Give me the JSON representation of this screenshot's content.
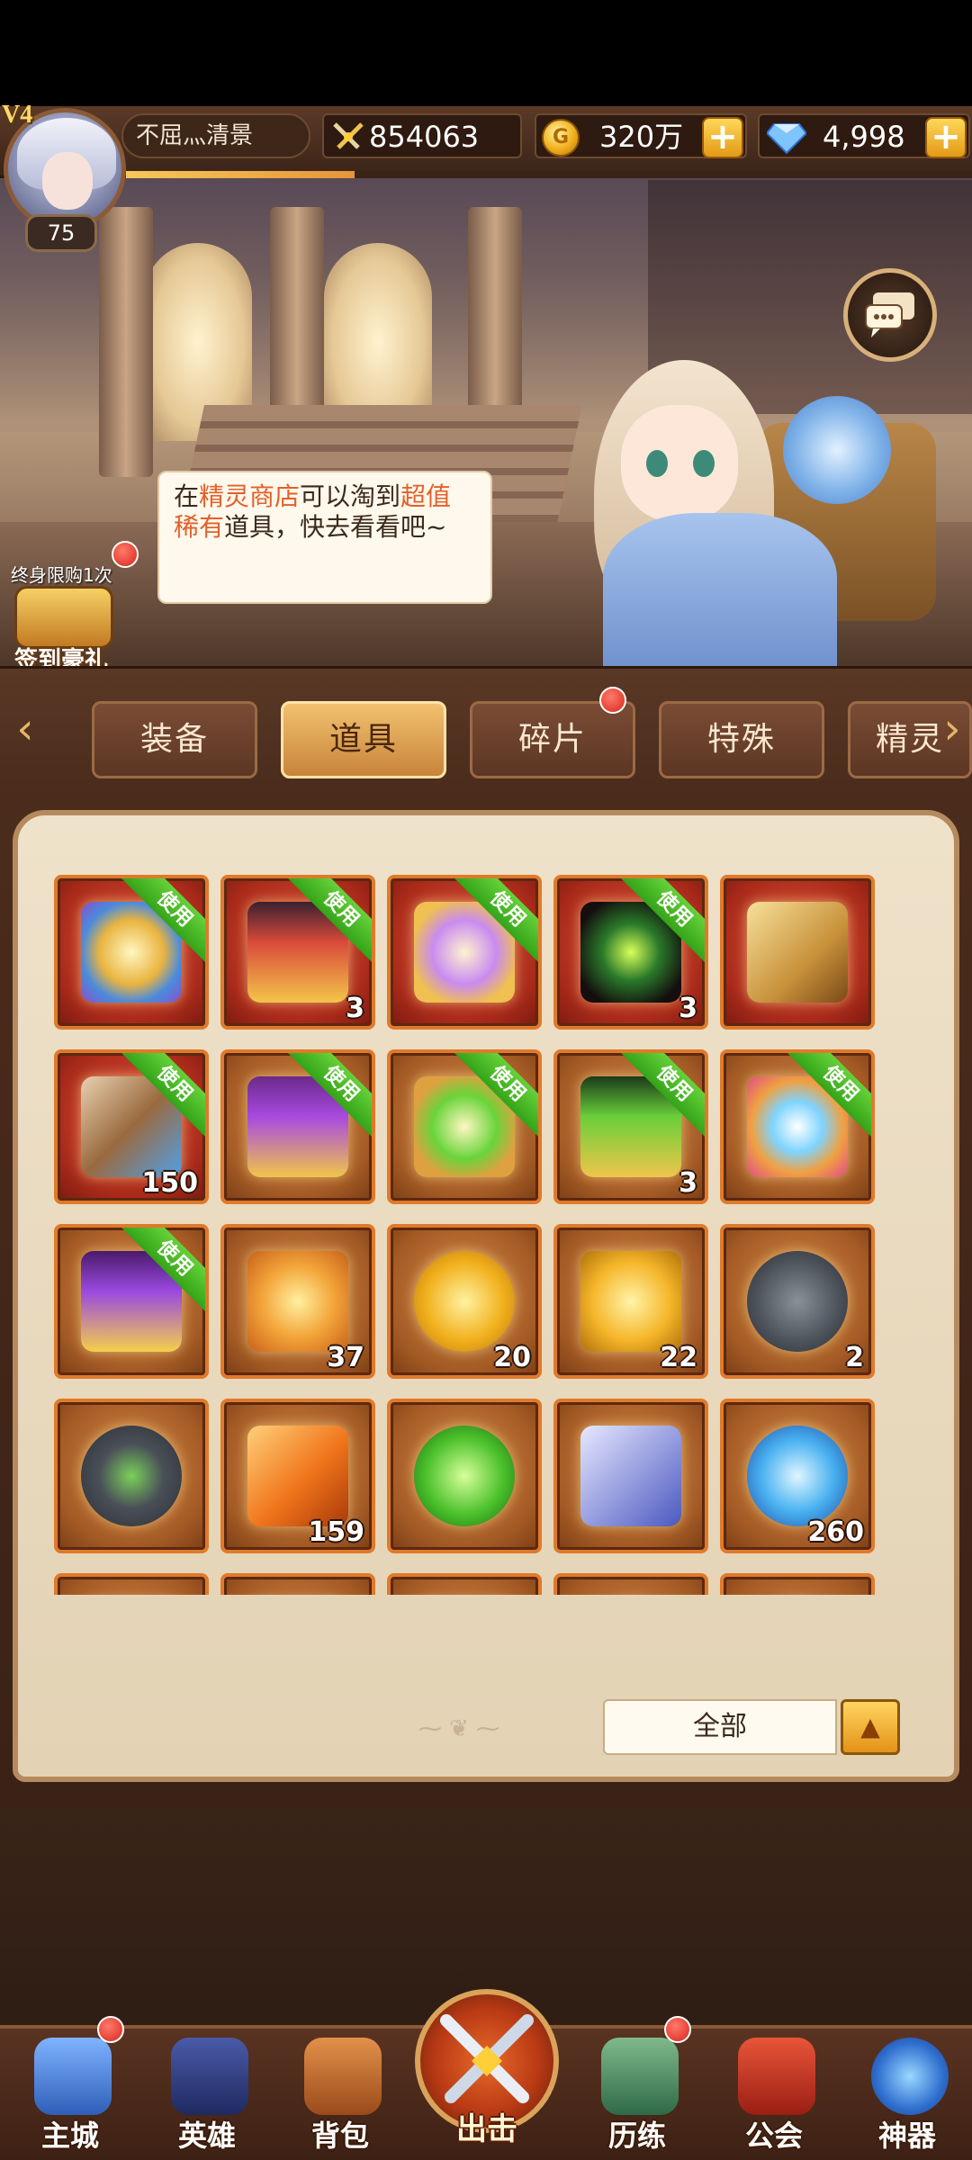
{
  "player": {
    "vip": "V4",
    "level": "75",
    "name": "不屈灬清景",
    "power": "854063",
    "gold": "320万",
    "diamonds": "4,998",
    "exp_progress": 0.27
  },
  "npc_bubble": {
    "t1": "在",
    "t2": "精灵商店",
    "t3": "可以淘到",
    "t4": "超值稀有",
    "t5": "道具，快去看看吧~"
  },
  "gift": {
    "limit_text": "终身限购1次",
    "label": "签到豪礼"
  },
  "tabs": [
    {
      "label": "装备"
    },
    {
      "label": "道具"
    },
    {
      "label": "碎片"
    },
    {
      "label": "特殊"
    },
    {
      "label": "精灵"
    }
  ],
  "use_label": "使用",
  "items": [
    {
      "icon": "tarot-card-bundle-icon",
      "count": "",
      "use": true
    },
    {
      "icon": "red-treasure-chest-icon",
      "count": "3",
      "use": true
    },
    {
      "icon": "purple-card-bundle-icon",
      "count": "",
      "use": true
    },
    {
      "icon": "demon-helmet-icon",
      "count": "3",
      "use": true
    },
    {
      "icon": "golden-cards-icon",
      "count": "",
      "use": false
    },
    {
      "icon": "blue-scroll-icon",
      "count": "150",
      "use": true
    },
    {
      "icon": "purple-chest-icon",
      "count": "",
      "use": true
    },
    {
      "icon": "green-card-bundle-icon",
      "count": "",
      "use": true
    },
    {
      "icon": "green-chest-icon",
      "count": "3",
      "use": true
    },
    {
      "icon": "rainbow-card-bundle-icon",
      "count": "",
      "use": true
    },
    {
      "icon": "purple-treasure-chest-icon",
      "count": "",
      "use": true
    },
    {
      "icon": "sun-crystal-icon",
      "count": "37",
      "use": false
    },
    {
      "icon": "gold-coin-icon",
      "count": "20",
      "use": false
    },
    {
      "icon": "gold-ingot-icon",
      "count": "22",
      "use": false
    },
    {
      "icon": "stone-rune-icon",
      "count": "2",
      "use": false
    },
    {
      "icon": "goblin-rune-icon",
      "count": "",
      "use": false
    },
    {
      "icon": "orange-crystal-icon",
      "count": "159",
      "use": false
    },
    {
      "icon": "green-gem-icon",
      "count": "",
      "use": false
    },
    {
      "icon": "silver-key-icon",
      "count": "",
      "use": false
    },
    {
      "icon": "blue-orb-icon",
      "count": "260",
      "use": false
    },
    {
      "icon": "rose-icon",
      "count": "",
      "use": false
    },
    {
      "icon": "cannon-icon",
      "count": "",
      "use": false
    },
    {
      "icon": "potion-bottle-icon",
      "count": "",
      "use": false
    },
    {
      "icon": "purple-rune-gem-icon",
      "count": "",
      "use": false
    },
    {
      "icon": "purple-rune-gem-icon",
      "count": "",
      "use": false
    }
  ],
  "filter": {
    "label": "全部",
    "button_icon": "▲"
  },
  "nav": [
    {
      "label": "主城",
      "icon": "castle-icon",
      "dot": true
    },
    {
      "label": "英雄",
      "icon": "knight-helmet-icon",
      "dot": false
    },
    {
      "label": "背包",
      "icon": "backpack-icon",
      "dot": false
    },
    {
      "label": "出击",
      "icon": "crossed-swords-icon",
      "dot": false
    },
    {
      "label": "历练",
      "icon": "training-icon",
      "dot": true
    },
    {
      "label": "公会",
      "icon": "guild-banner-icon",
      "dot": false
    },
    {
      "label": "神器",
      "icon": "artifact-orb-icon",
      "dot": false
    }
  ],
  "colors": {
    "accent_orange": "#e07a2a",
    "use_green": "#34a318",
    "notify_red": "#d8261c",
    "highlight_text": "#e3612a"
  }
}
